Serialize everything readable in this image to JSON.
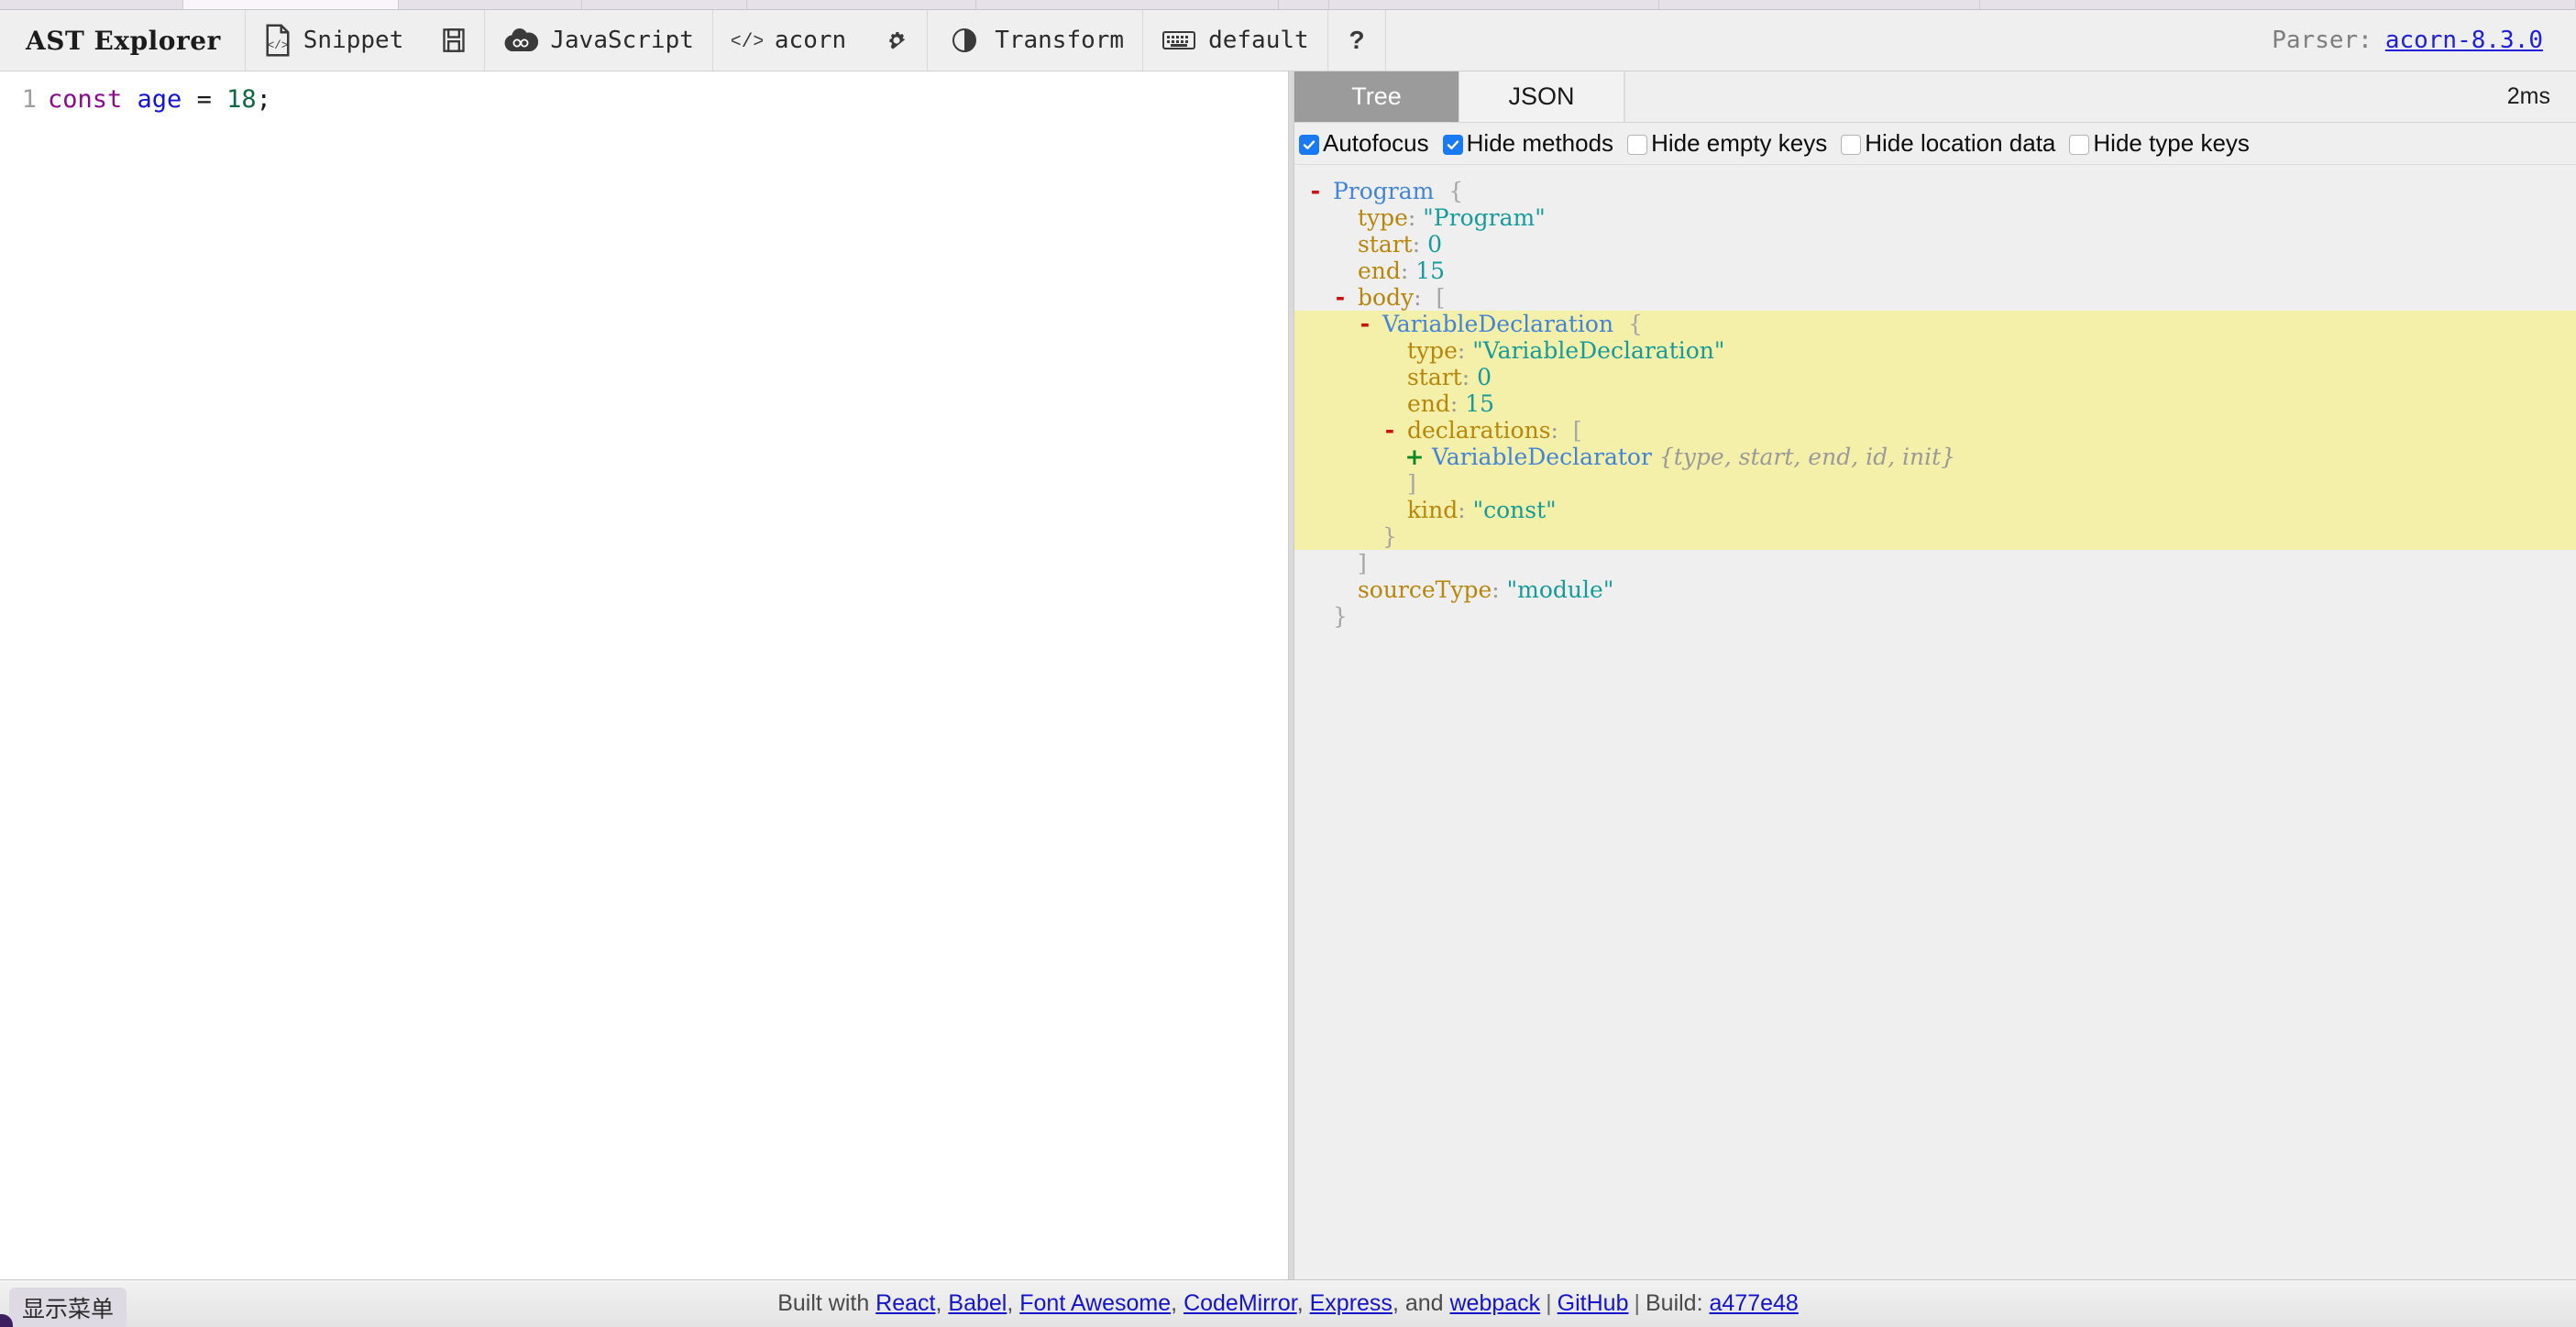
{
  "app": {
    "brand": "AST Explorer"
  },
  "toolbar": {
    "items": [
      {
        "icon": "file-code-icon",
        "label": "Snippet"
      },
      {
        "icon": "floppy-save-icon",
        "label": ""
      },
      {
        "icon": "javascript-cloud-icon",
        "label": "JavaScript"
      },
      {
        "icon": "code-brackets-icon",
        "label": "acorn"
      },
      {
        "icon": "gear-icon",
        "label": ""
      },
      {
        "icon": "transform-toggle-icon",
        "label": "Transform"
      },
      {
        "icon": "keyboard-icon",
        "label": "default"
      },
      {
        "icon": "question-mark-icon",
        "label": ""
      }
    ],
    "snippet_label": "Snippet",
    "language_label": "JavaScript",
    "parser_label": "acorn",
    "transform_label": "Transform",
    "keymap_label": "default",
    "parser_info_label": "Parser:",
    "parser_version": "acorn-8.3.0"
  },
  "editor": {
    "line_number": "1",
    "tokens": {
      "kw": "const",
      "space1": " ",
      "ident": "age",
      "op": " = ",
      "num": "18",
      "semi": ";"
    }
  },
  "ast_panel": {
    "tabs": [
      {
        "label": "Tree",
        "active": true
      },
      {
        "label": "JSON",
        "active": false
      }
    ],
    "tab_tree": "Tree",
    "tab_json": "JSON",
    "timing": "2ms",
    "options": [
      {
        "label": "Autofocus",
        "checked": true
      },
      {
        "label": "Hide methods",
        "checked": true
      },
      {
        "label": "Hide empty keys",
        "checked": false
      },
      {
        "label": "Hide location data",
        "checked": false
      },
      {
        "label": "Hide type keys",
        "checked": false
      }
    ],
    "opt0": "Autofocus",
    "opt1": "Hide methods",
    "opt2": "Hide empty keys",
    "opt3": "Hide location data",
    "opt4": "Hide type keys"
  },
  "tree": {
    "rows": [
      {
        "indent": 0,
        "toggle": "-",
        "node": "Program",
        "open": "{"
      },
      {
        "indent": 1,
        "toggle": "",
        "key": "type",
        "str": "\"Program\""
      },
      {
        "indent": 1,
        "toggle": "",
        "key": "start",
        "num": "0"
      },
      {
        "indent": 1,
        "toggle": "",
        "key": "end",
        "num": "15"
      },
      {
        "indent": 1,
        "toggle": "-",
        "key": "body",
        "open": "["
      },
      {
        "indent": 2,
        "toggle": "-",
        "node": "VariableDeclaration",
        "open": "{",
        "hl": true
      },
      {
        "indent": 3,
        "toggle": "",
        "key": "type",
        "str": "\"VariableDeclaration\"",
        "hl": true
      },
      {
        "indent": 3,
        "toggle": "",
        "key": "start",
        "num": "0",
        "hl": true
      },
      {
        "indent": 3,
        "toggle": "",
        "key": "end",
        "num": "15",
        "hl": true
      },
      {
        "indent": 3,
        "toggle": "-",
        "key": "declarations",
        "open": "[",
        "hl": true
      },
      {
        "indent": 4,
        "toggle": "+",
        "node": "VariableDeclarator",
        "preview": "{type, start, end, id, init}",
        "hl": true
      },
      {
        "indent": 3,
        "toggle": "",
        "close": "]",
        "hl": true
      },
      {
        "indent": 3,
        "toggle": "",
        "key": "kind",
        "str": "\"const\"",
        "hl": true
      },
      {
        "indent": 2,
        "toggle": "",
        "close": "}",
        "hl": true
      },
      {
        "indent": 1,
        "toggle": "",
        "close": "]"
      },
      {
        "indent": 1,
        "toggle": "",
        "key": "sourceType",
        "str": "\"module\""
      },
      {
        "indent": 0,
        "toggle": "",
        "close": "}"
      }
    ]
  },
  "footer": {
    "show_menu": "显示菜单",
    "built_with": "Built with ",
    "links": [
      "React",
      "Babel",
      "Font Awesome",
      "CodeMirror",
      "Express",
      "webpack"
    ],
    "l0": "React",
    "l1": "Babel",
    "l2": "Font Awesome",
    "l3": "CodeMirror",
    "l4": "Express",
    "l5": "webpack",
    "and_word": ", and ",
    "github": "GitHub",
    "build_label": "Build:",
    "build_hash": "a477e48",
    "sep": "|",
    "comma": ", "
  },
  "colors": {
    "accent_checkbox": "#1a7af4",
    "highlight": "#f4efa9",
    "node_blue": "#4384d6",
    "key_gold": "#b8860b",
    "string_teal": "#169b9b",
    "link_blue": "#1414cc",
    "tab_active_bg": "#9b9b9b"
  }
}
